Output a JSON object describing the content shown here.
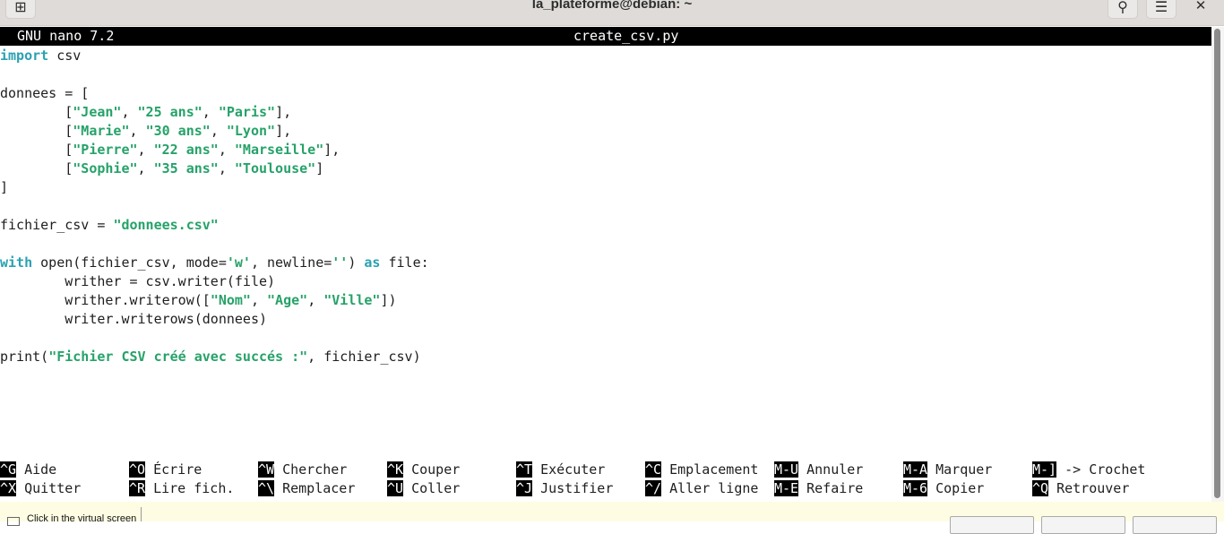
{
  "window": {
    "title": "la_plateforme@debian: ~",
    "new_tab_icon": "plus-square-icon",
    "search_icon": "search-icon",
    "menu_icon": "hamburger-icon",
    "close_icon": "close-icon"
  },
  "nano": {
    "version": "GNU nano 7.2",
    "filename": "create_csv.py"
  },
  "code": [
    [
      [
        "kw",
        "import"
      ],
      [
        "p",
        " csv"
      ]
    ],
    [],
    [
      [
        "p",
        "donnees = ["
      ]
    ],
    [
      [
        "p",
        "        ["
      ],
      [
        "str",
        "\"Jean\""
      ],
      [
        "p",
        ", "
      ],
      [
        "str",
        "\"25 ans\""
      ],
      [
        "p",
        ", "
      ],
      [
        "str",
        "\"Paris\""
      ],
      [
        "p",
        "],"
      ]
    ],
    [
      [
        "p",
        "        ["
      ],
      [
        "str",
        "\"Marie\""
      ],
      [
        "p",
        ", "
      ],
      [
        "str",
        "\"30 ans\""
      ],
      [
        "p",
        ", "
      ],
      [
        "str",
        "\"Lyon\""
      ],
      [
        "p",
        "],"
      ]
    ],
    [
      [
        "p",
        "        ["
      ],
      [
        "str",
        "\"Pierre\""
      ],
      [
        "p",
        ", "
      ],
      [
        "str",
        "\"22 ans\""
      ],
      [
        "p",
        ", "
      ],
      [
        "str",
        "\"Marseille\""
      ],
      [
        "p",
        "],"
      ]
    ],
    [
      [
        "p",
        "        ["
      ],
      [
        "str",
        "\"Sophie\""
      ],
      [
        "p",
        ", "
      ],
      [
        "str",
        "\"35 ans\""
      ],
      [
        "p",
        ", "
      ],
      [
        "str",
        "\"Toulouse\""
      ],
      [
        "p",
        "]"
      ]
    ],
    [
      [
        "p",
        "]"
      ]
    ],
    [],
    [
      [
        "p",
        "fichier_csv = "
      ],
      [
        "str",
        "\"donnees.csv\""
      ]
    ],
    [],
    [
      [
        "kw",
        "with"
      ],
      [
        "p",
        " open(fichier_csv, mode="
      ],
      [
        "str",
        "'w'"
      ],
      [
        "p",
        ", newline="
      ],
      [
        "str",
        "''"
      ],
      [
        "p",
        ") "
      ],
      [
        "kw",
        "as"
      ],
      [
        "p",
        " file:"
      ]
    ],
    [
      [
        "p",
        "        writher = csv.writer(file)"
      ]
    ],
    [
      [
        "p",
        "        writher.writerow(["
      ],
      [
        "str",
        "\"Nom\""
      ],
      [
        "p",
        ", "
      ],
      [
        "str",
        "\"Age\""
      ],
      [
        "p",
        ", "
      ],
      [
        "str",
        "\"Ville\""
      ],
      [
        "p",
        "])"
      ]
    ],
    [
      [
        "p",
        "        writer.writerows(donnees)"
      ]
    ],
    [],
    [
      [
        "p",
        "print("
      ],
      [
        "str",
        "\"Fichier CSV créé avec succés :\""
      ],
      [
        "p",
        ", fichier_csv)"
      ]
    ]
  ],
  "shortcuts": [
    [
      {
        "key": "^G",
        "label": "Aide"
      },
      {
        "key": "^O",
        "label": "Écrire"
      },
      {
        "key": "^W",
        "label": "Chercher"
      },
      {
        "key": "^K",
        "label": "Couper"
      },
      {
        "key": "^T",
        "label": "Exécuter"
      },
      {
        "key": "^C",
        "label": "Emplacement"
      },
      {
        "key": "M-U",
        "label": "Annuler"
      },
      {
        "key": "M-A",
        "label": "Marquer"
      },
      {
        "key": "M-]",
        "label": "-> Crochet"
      }
    ],
    [
      {
        "key": "^X",
        "label": "Quitter"
      },
      {
        "key": "^R",
        "label": "Lire fich."
      },
      {
        "key": "^\\",
        "label": "Remplacer"
      },
      {
        "key": "^U",
        "label": "Coller"
      },
      {
        "key": "^J",
        "label": "Justifier"
      },
      {
        "key": "^/",
        "label": "Aller ligne"
      },
      {
        "key": "M-E",
        "label": "Refaire"
      },
      {
        "key": "M-6",
        "label": "Copier"
      },
      {
        "key": "^Q",
        "label": "Retrouver"
      }
    ]
  ],
  "hint": {
    "text": "Click in the virtual screen"
  }
}
